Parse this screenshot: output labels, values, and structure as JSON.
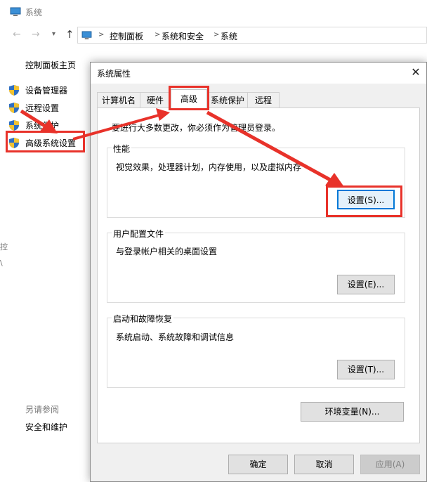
{
  "background_window": {
    "title": "系统",
    "breadcrumb": [
      "控制面板",
      "系统和安全",
      "系统"
    ],
    "sidebar": {
      "home": "控制面板主页",
      "items": [
        {
          "label": "设备管理器",
          "icon": "shield-icon"
        },
        {
          "label": "远程设置",
          "icon": "shield-icon"
        },
        {
          "label": "系统保护",
          "icon": "shield-icon"
        },
        {
          "label": "高级系统设置",
          "icon": "shield-icon"
        }
      ],
      "see_also": "另请参阅",
      "security_maintenance": "安全和维护"
    },
    "left_cut": [
      "控",
      "\\"
    ]
  },
  "dialog": {
    "title": "系统属性",
    "close_icon": "close-icon",
    "tabs": [
      {
        "label": "计算机名"
      },
      {
        "label": "硬件"
      },
      {
        "label": "高级",
        "active": true
      },
      {
        "label": "系统保护"
      },
      {
        "label": "远程"
      }
    ],
    "admin_note": "要进行大多数更改，你必须作为管理员登录。",
    "performance": {
      "title": "性能",
      "description": "视觉效果，处理器计划，内存使用，以及虚拟内存",
      "button": "设置(S)..."
    },
    "user_profiles": {
      "title": "用户配置文件",
      "description": "与登录帐户相关的桌面设置",
      "button": "设置(E)..."
    },
    "startup_recovery": {
      "title": "启动和故障恢复",
      "description": "系统启动、系统故障和调试信息",
      "button": "设置(T)..."
    },
    "env_button": "环境变量(N)...",
    "ok": "确定",
    "cancel": "取消",
    "apply": "应用(A)"
  },
  "colors": {
    "annotation_red": "#e8322a",
    "focus_blue": "#0078d7",
    "dialog_bg": "#f0f0f0"
  }
}
